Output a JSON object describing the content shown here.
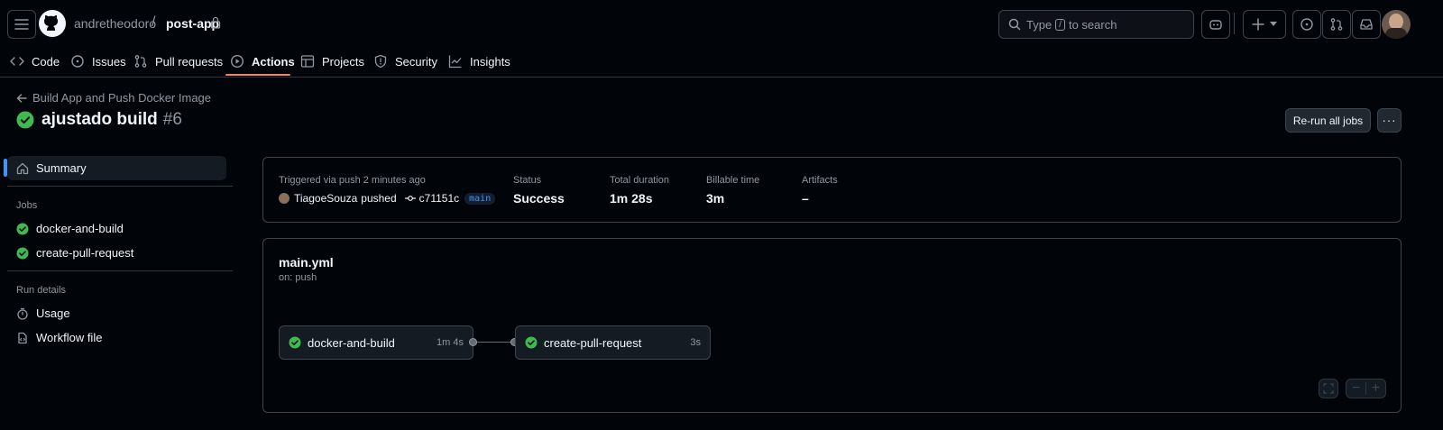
{
  "header": {
    "owner": "andretheodoro",
    "separator": "/",
    "repo": "post-app",
    "search": {
      "prefix": "Type",
      "key": "/",
      "suffix": "to search"
    }
  },
  "tabs": [
    {
      "label": "Code",
      "icon": "code-icon"
    },
    {
      "label": "Issues",
      "icon": "issue-icon"
    },
    {
      "label": "Pull requests",
      "icon": "pull-request-icon"
    },
    {
      "label": "Actions",
      "icon": "play-icon",
      "active": true
    },
    {
      "label": "Projects",
      "icon": "table-icon"
    },
    {
      "label": "Security",
      "icon": "shield-icon"
    },
    {
      "label": "Insights",
      "icon": "graph-icon"
    }
  ],
  "run": {
    "workflow_name": "Build App and Push Docker Image",
    "title": "ajustado build",
    "number": "#6",
    "rerun_label": "Re-run all jobs",
    "more_label": "···"
  },
  "sidebar": {
    "summary": "Summary",
    "jobs_heading": "Jobs",
    "jobs": [
      "docker-and-build",
      "create-pull-request"
    ],
    "run_details_heading": "Run details",
    "details": [
      "Usage",
      "Workflow file"
    ]
  },
  "summary": {
    "trigger_label": "Triggered via push 2 minutes ago",
    "actor": "TiagoeSouza",
    "action": "pushed",
    "commit": "c71151c",
    "branch": "main",
    "status_label": "Status",
    "status_value": "Success",
    "duration_label": "Total duration",
    "duration_value": "1m 28s",
    "billable_label": "Billable time",
    "billable_value": "3m",
    "artifacts_label": "Artifacts",
    "artifacts_value": "–"
  },
  "workflow": {
    "file": "main.yml",
    "trigger": "on: push",
    "jobs": [
      {
        "name": "docker-and-build",
        "duration": "1m 4s"
      },
      {
        "name": "create-pull-request",
        "duration": "3s"
      }
    ]
  },
  "zoom": {
    "minus": "−",
    "plus": "+"
  },
  "colors": {
    "success": "#3fb950",
    "accent": "#4493f8",
    "active_tab": "#f78166"
  }
}
